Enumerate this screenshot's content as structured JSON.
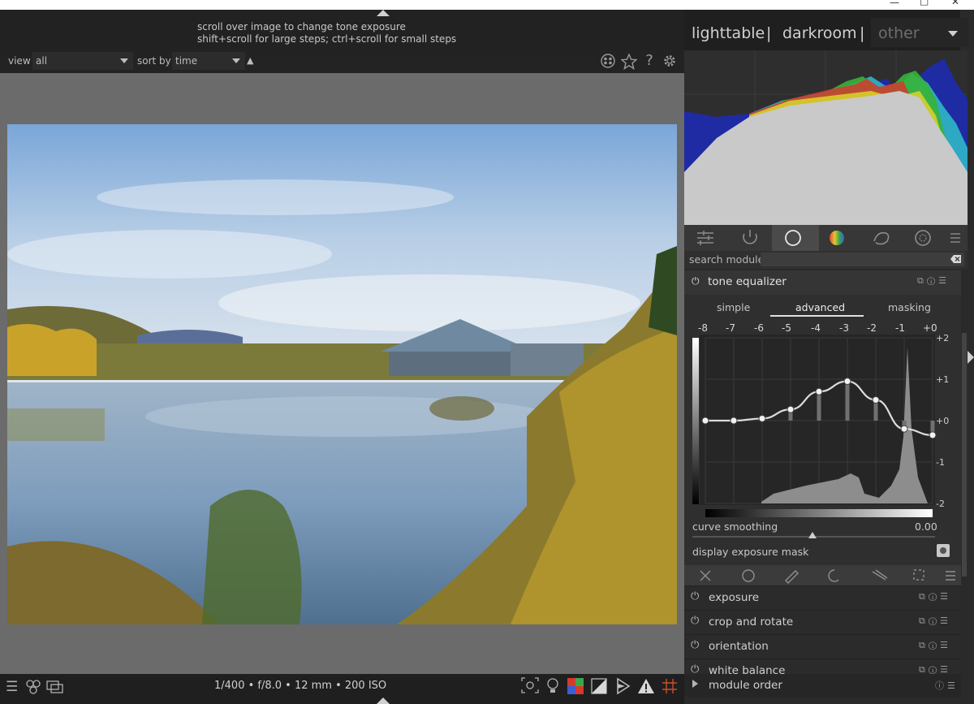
{
  "window": {
    "minimize": "—",
    "maximize": "□",
    "close": "✕"
  },
  "header": {
    "hint_line1": "scroll over image to change tone exposure",
    "hint_line2": "shift+scroll for large steps; ctrl+scroll for small steps"
  },
  "filter": {
    "view_label": "view",
    "view_value": "all",
    "sort_label": "sort by",
    "sort_value": "time",
    "sort_order_glyph": "▲",
    "icons": [
      "grouping-icon",
      "star-icon",
      "help-icon",
      "gear-icon"
    ]
  },
  "views": {
    "lighttable": "lighttable",
    "sep1": "|",
    "darkroom": "darkroom",
    "sep2": "|",
    "other": "other"
  },
  "module_tabs": [
    "quick-access-icon",
    "active-modules-icon",
    "base-modules-icon",
    "color-modules-icon",
    "correct-modules-icon",
    "effect-modules-icon",
    "presets-menu-icon"
  ],
  "search": {
    "label": "search module"
  },
  "tone_equalizer": {
    "title": "tone equalizer",
    "tabs": [
      "simple",
      "advanced",
      "masking"
    ],
    "active_tab": "advanced",
    "ev_labels": [
      "-8",
      "-7",
      "-6",
      "-5",
      "-4",
      "-3",
      "-2",
      "-1",
      "+0"
    ],
    "y_labels": [
      "+2",
      "+1",
      "+0",
      "-1",
      "-2"
    ],
    "curve_ev": [
      -8,
      -7,
      -6,
      -5,
      -4,
      -3,
      -2,
      -1,
      0
    ],
    "curve_values": [
      0,
      0,
      0.05,
      0.27,
      0.7,
      0.95,
      0.5,
      -0.2,
      -0.35
    ],
    "curve_smoothing_label": "curve smoothing",
    "curve_smoothing_value": "0.00",
    "display_mask_label": "display exposure mask"
  },
  "modules": [
    {
      "label": "exposure"
    },
    {
      "label": "crop and rotate"
    },
    {
      "label": "orientation"
    },
    {
      "label": "white balance"
    }
  ],
  "bottom": {
    "exif": "1/400 • f/8.0 • 12 mm • 200 ISO",
    "module_order_label": "module order",
    "left_icons": [
      "menu-icon",
      "styles-icon",
      "display-icon"
    ],
    "right_icons": [
      "focus-peaking-icon",
      "raw-overexposed-icon",
      "color-assessment-icon",
      "overexposed-icon",
      "softproof-icon",
      "gamut-check-icon",
      "guides-icon"
    ]
  },
  "colors": {
    "accent": "#e8e8e8",
    "background": "#1c1c1c",
    "panel": "#2a2a2a"
  }
}
